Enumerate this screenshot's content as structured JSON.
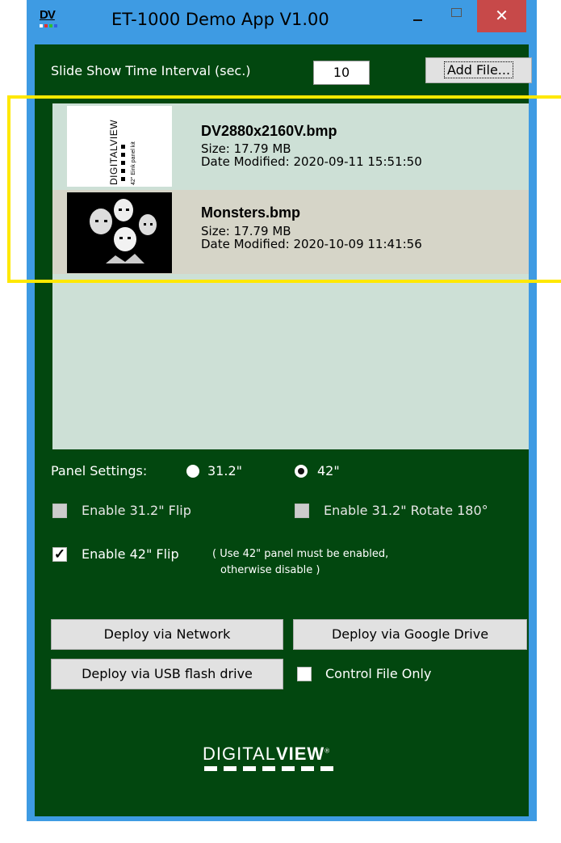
{
  "window": {
    "title": "ET-1000 Demo App V1.00",
    "app_icon_text": "DV",
    "controls": {
      "minimize": "–",
      "maximize": "□",
      "close": "✕"
    }
  },
  "interval": {
    "label": "Slide Show Time Interval (sec.)",
    "value": "10"
  },
  "add_file_label": "Add File...",
  "files": [
    {
      "name": "DV2880x2160V.bmp",
      "size": "Size: 17.79 MB",
      "modified": "Date Modified: 2020-09-11 15:51:50",
      "thumb_logo": "DIGITALVIEW",
      "thumb_caption": "42\" Eink panel kit"
    },
    {
      "name": "Monsters.bmp",
      "size": "Size: 17.79 MB",
      "modified": "Date Modified: 2020-10-09 11:41:56"
    }
  ],
  "panel_settings": {
    "label": "Panel Settings:",
    "options": [
      {
        "label": "31.2\"",
        "checked": false
      },
      {
        "label": "42\"",
        "checked": true
      }
    ]
  },
  "options": {
    "flip_31": "Enable 31.2\" Flip",
    "rotate_31": "Enable 31.2\" Rotate 180°",
    "flip_42": "Enable 42\" Flip",
    "flip_42_note_line1": "( Use 42\" panel must be enabled,",
    "flip_42_note_line2": "otherwise disable )"
  },
  "deploy": {
    "network": "Deploy via Network",
    "google_drive": "Deploy via Google Drive",
    "usb": "Deploy via USB flash drive",
    "control_file_only": "Control File Only"
  },
  "logo": {
    "text_light": "DIGITAL",
    "text_bold": "VIEW",
    "mark": "®"
  },
  "colors": {
    "titlebar": "#3e9be3",
    "client": "#02470f",
    "list_bg": "#cde0d6",
    "selected_row": "#d6d5c8",
    "highlight": "#ffe800",
    "close": "#c74949"
  }
}
